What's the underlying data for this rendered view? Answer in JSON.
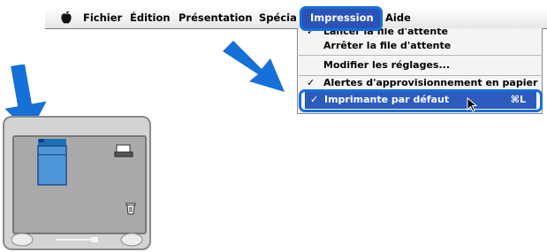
{
  "menubar": {
    "items": [
      "Fichier",
      "Édition",
      "Présentation",
      "Spécia",
      "Impression",
      "Aide"
    ],
    "active_index": 4
  },
  "menu": {
    "items": [
      {
        "label": "Lancer la file d'attente",
        "checked": true
      },
      {
        "label": "Arrêter la file d'attente",
        "checked": false
      },
      {
        "label": "Modifier les réglages...",
        "checked": false
      },
      {
        "label": "Alertes d'approvisionnement en papier",
        "checked": true
      },
      {
        "label": "Imprimante par défaut",
        "checked": true,
        "shortcut": "⌘L",
        "highlighted": true
      }
    ]
  },
  "colors": {
    "highlight": "#2d5bbd",
    "callout": "#1570d8"
  },
  "icons": [
    "apple-icon",
    "arrow-icon",
    "printer-icon",
    "trash-icon",
    "mouse-cursor-icon"
  ]
}
